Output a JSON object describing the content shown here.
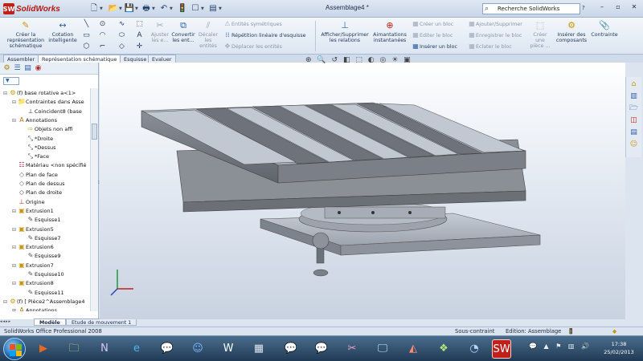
{
  "app": {
    "logo_text": "SolidWorks",
    "logo_badge": "SW",
    "document_title": "Assemblage4 *"
  },
  "search": {
    "placeholder": "Recherche SolidWorks",
    "help": "?"
  },
  "window_controls": {
    "minimize": "–",
    "restore": "▫",
    "close": "✕"
  },
  "ribbon": {
    "create_sketch": "Créer la représentation schématique",
    "smart_dimension": "Cotation intelligente",
    "adjust": "Ajuster les e...",
    "convert": "Convertir les ent...",
    "offset": "Décaler les entités",
    "mirror": "Entités symétriques",
    "linear_pattern": "Répétition linéaire d'esquisse",
    "move": "Déplacer les entités",
    "show_relations": "Afficher/Supprimer les relations",
    "quick_snaps": "Aimantations instantanées",
    "create_block": "Créer un bloc",
    "edit_block": "Editer le bloc",
    "insert_block": "Insérer un bloc",
    "add_remove": "Ajouter/Supprimer",
    "save_block": "Enregistrer le bloc",
    "explode_block": "Eclater le bloc",
    "create_part": "Créer une pièce ...",
    "insert_components": "Insérer des composants",
    "constraint": "Contrainte"
  },
  "tabs": [
    "Assembler",
    "Représentation schématique",
    "Esquisse",
    "Evaluer"
  ],
  "active_tab": "Représentation schématique",
  "feature_tree": [
    {
      "label": "(f) base rotative a<1>",
      "icon": "part-icon",
      "level": 0,
      "toggle": "⊟"
    },
    {
      "label": "Contraintes dans Asse",
      "icon": "mates-folder-icon",
      "level": 1,
      "toggle": "⊟"
    },
    {
      "label": "Coincident8 (base",
      "icon": "coincident-mate-icon",
      "level": 2,
      "toggle": ""
    },
    {
      "label": "Annotations",
      "icon": "annotations-icon",
      "level": 1,
      "toggle": "⊟"
    },
    {
      "label": "Objets non affi",
      "icon": "hidden-objects-icon",
      "level": 2,
      "toggle": ""
    },
    {
      "label": "*Droite",
      "icon": "view-icon",
      "level": 2,
      "toggle": ""
    },
    {
      "label": "*Dessus",
      "icon": "view-icon",
      "level": 2,
      "toggle": ""
    },
    {
      "label": "*Face",
      "icon": "view-icon",
      "level": 2,
      "toggle": ""
    },
    {
      "label": "Matériau <non spécifié",
      "icon": "material-icon",
      "level": 1,
      "toggle": ""
    },
    {
      "label": "Plan de face",
      "icon": "plane-icon",
      "level": 1,
      "toggle": ""
    },
    {
      "label": "Plan de dessus",
      "icon": "plane-icon",
      "level": 1,
      "toggle": ""
    },
    {
      "label": "Plan de droite",
      "icon": "plane-icon",
      "level": 1,
      "toggle": ""
    },
    {
      "label": "Origine",
      "icon": "origin-icon",
      "level": 1,
      "toggle": ""
    },
    {
      "label": "Extrusion1",
      "icon": "extrude-icon",
      "level": 1,
      "toggle": "⊟"
    },
    {
      "label": "Esquisse1",
      "icon": "sketch-icon",
      "level": 2,
      "toggle": ""
    },
    {
      "label": "Extrusion5",
      "icon": "extrude-icon",
      "level": 1,
      "toggle": "⊟"
    },
    {
      "label": "Esquisse7",
      "icon": "sketch-icon",
      "level": 2,
      "toggle": ""
    },
    {
      "label": "Extrusion6",
      "icon": "extrude-icon",
      "level": 1,
      "toggle": "⊟"
    },
    {
      "label": "Esquisse9",
      "icon": "sketch-icon",
      "level": 2,
      "toggle": ""
    },
    {
      "label": "Extrusion7",
      "icon": "extrude-icon",
      "level": 1,
      "toggle": "⊟"
    },
    {
      "label": "Esquisse10",
      "icon": "sketch-icon",
      "level": 2,
      "toggle": ""
    },
    {
      "label": "Extrusion8",
      "icon": "extrude-icon",
      "level": 1,
      "toggle": "⊟"
    },
    {
      "label": "Esquisse11",
      "icon": "sketch-icon",
      "level": 2,
      "toggle": ""
    },
    {
      "label": "(f) [ Pièce2^Assemblage4",
      "icon": "part-icon",
      "level": 0,
      "toggle": "⊟"
    },
    {
      "label": "Annotations",
      "icon": "annotations-icon",
      "level": 1,
      "toggle": "⊞"
    }
  ],
  "bottom_tabs": [
    "Modèle",
    "Etude de mouvement 1"
  ],
  "status": {
    "product": "SolidWorks Office Professional 2008",
    "definition": "Sous-contraint",
    "mode": "Edition: Assemblage"
  },
  "clock": {
    "time": "17:38",
    "date": "25/02/2013"
  },
  "colors": {
    "sw_red": "#c0201a",
    "ribbon_bg": "#e6eef7",
    "taskbar": "#2b4a68",
    "model_gray": "#a9b0bc"
  }
}
